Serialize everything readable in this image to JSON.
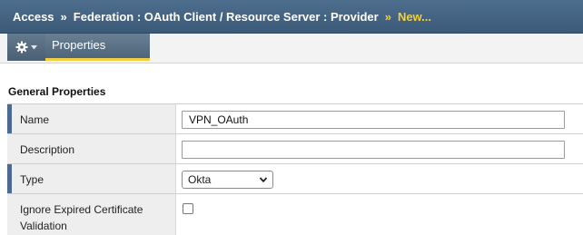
{
  "breadcrumb": {
    "items": [
      "Access",
      "Federation : OAuth Client / Resource Server : Provider"
    ],
    "current": "New...",
    "separator": "»"
  },
  "toolbar": {
    "gear_icon": "gear-icon",
    "tab_label": "Properties"
  },
  "section": {
    "title": "General Properties"
  },
  "fields": {
    "name": {
      "label": "Name",
      "value": "VPN_OAuth"
    },
    "description": {
      "label": "Description",
      "value": ""
    },
    "type": {
      "label": "Type",
      "selected": "Okta"
    },
    "ignore_expired": {
      "label": "Ignore Expired Certificate Validation",
      "checked": false
    }
  },
  "colors": {
    "header_bg": "#3b5a78",
    "accent_yellow": "#f2cf3f",
    "required_marker": "#4a6a8f"
  }
}
